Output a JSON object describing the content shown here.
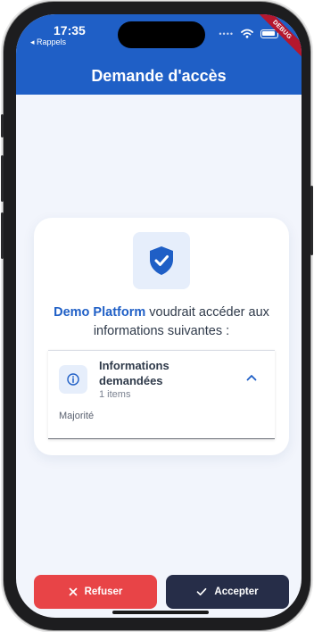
{
  "status_bar": {
    "time": "17:35",
    "back_label": "◂ Rappels",
    "debug_label": "DEBUG"
  },
  "appbar": {
    "title": "Demande d'accès"
  },
  "request": {
    "brand": "Demo Platform",
    "message_rest": " voudrait accéder aux informations suivantes :"
  },
  "info_panel": {
    "title": "Informations demandées",
    "count": "1 items",
    "items": [
      "Majorité"
    ]
  },
  "actions": {
    "refuse_label": "Refuser",
    "accept_label": "Accepter"
  },
  "colors": {
    "primary": "#1f5fc6",
    "refuse": "#e84447",
    "accept": "#262d48",
    "debug": "#b5172e"
  },
  "icons": {
    "shield": "shield-check-icon",
    "info": "info-icon",
    "chevron": "chevron-up-icon",
    "refuse": "close-icon",
    "accept": "check-icon"
  }
}
